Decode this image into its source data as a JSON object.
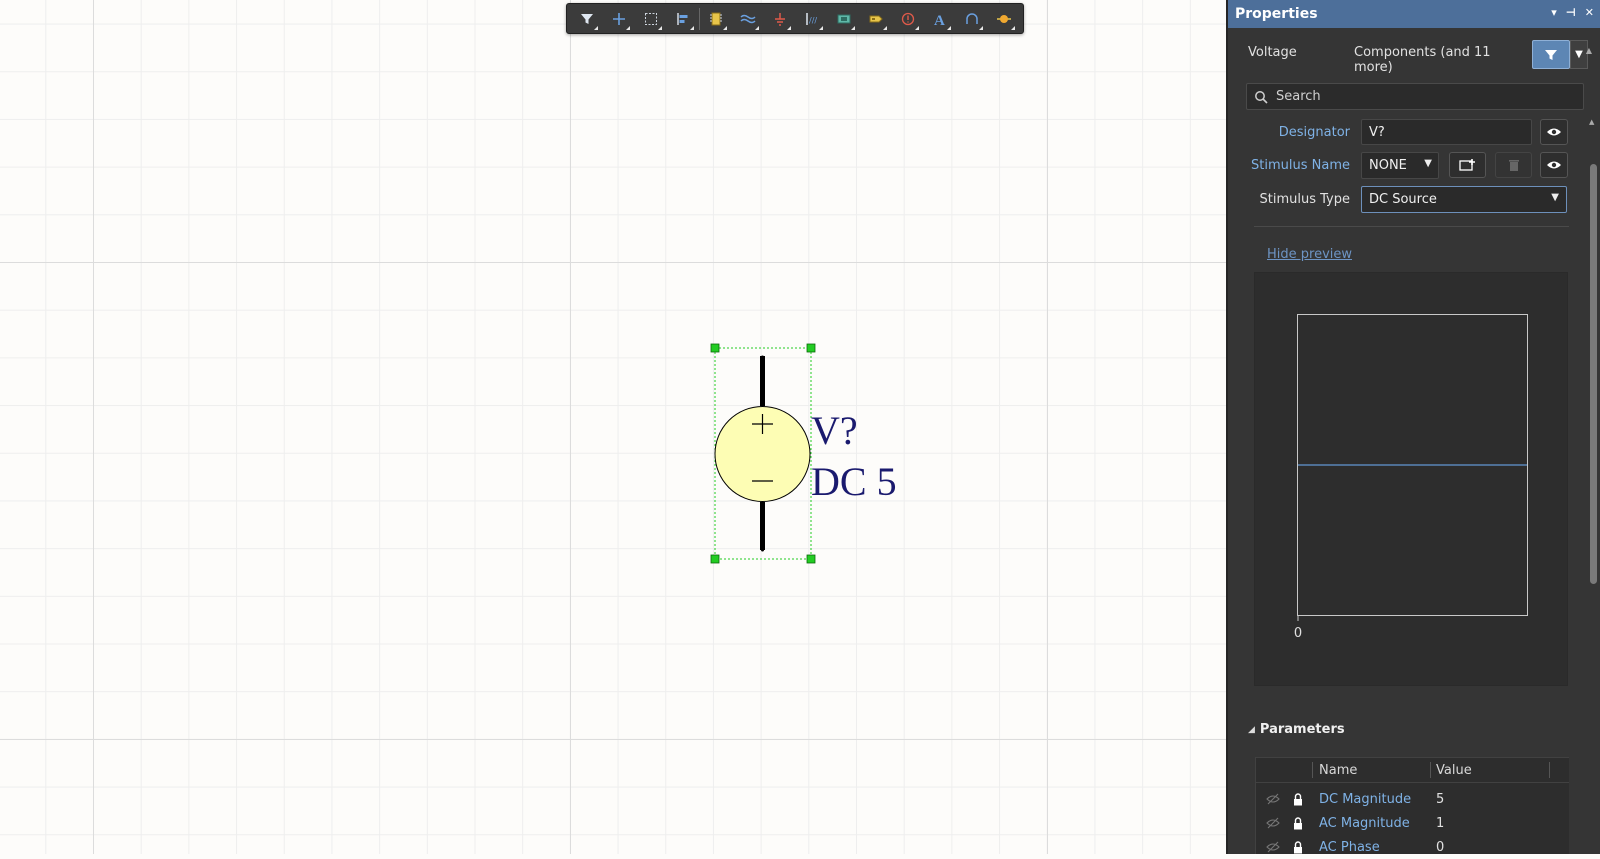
{
  "toolbar": {
    "icons": [
      "filter-icon",
      "add-wire-icon",
      "select-area-icon",
      "align-icon",
      "place-part-icon",
      "bus-icon",
      "ground-power-icon",
      "net-label-icon",
      "harness-icon",
      "port-icon",
      "no-erc-icon",
      "text-icon",
      "arc-icon",
      "net-color-icon"
    ]
  },
  "schematic": {
    "designator": "V?",
    "value_label": "DC 5",
    "plus_sign": "+",
    "minus_sign": "—"
  },
  "panel": {
    "title": "Properties",
    "object_type": "Voltage",
    "filter_summary": "Components (and 11 more)",
    "search_placeholder": "Search",
    "designator_label": "Designator",
    "designator_value": "V?",
    "stimulus_name_label": "Stimulus Name",
    "stimulus_name_value": "NONE",
    "stimulus_type_label": "Stimulus Type",
    "stimulus_type_value": "DC Source",
    "hide_preview_link": "Hide preview",
    "preview_x_tick": "0",
    "parameters_heading": "Parameters",
    "parameters_columns": [
      "Name",
      "Value"
    ],
    "parameters_rows": [
      {
        "name": "DC Magnitude",
        "value": "5"
      },
      {
        "name": "AC Magnitude",
        "value": "1"
      },
      {
        "name": "AC Phase",
        "value": "0"
      }
    ]
  },
  "colors": {
    "panel_header": "#4d6f9a",
    "accent_blue": "#7fb2e6",
    "schematic_text": "#1a1a6e",
    "source_fill": "#fdfdb4",
    "selection_green": "#22cc22"
  }
}
